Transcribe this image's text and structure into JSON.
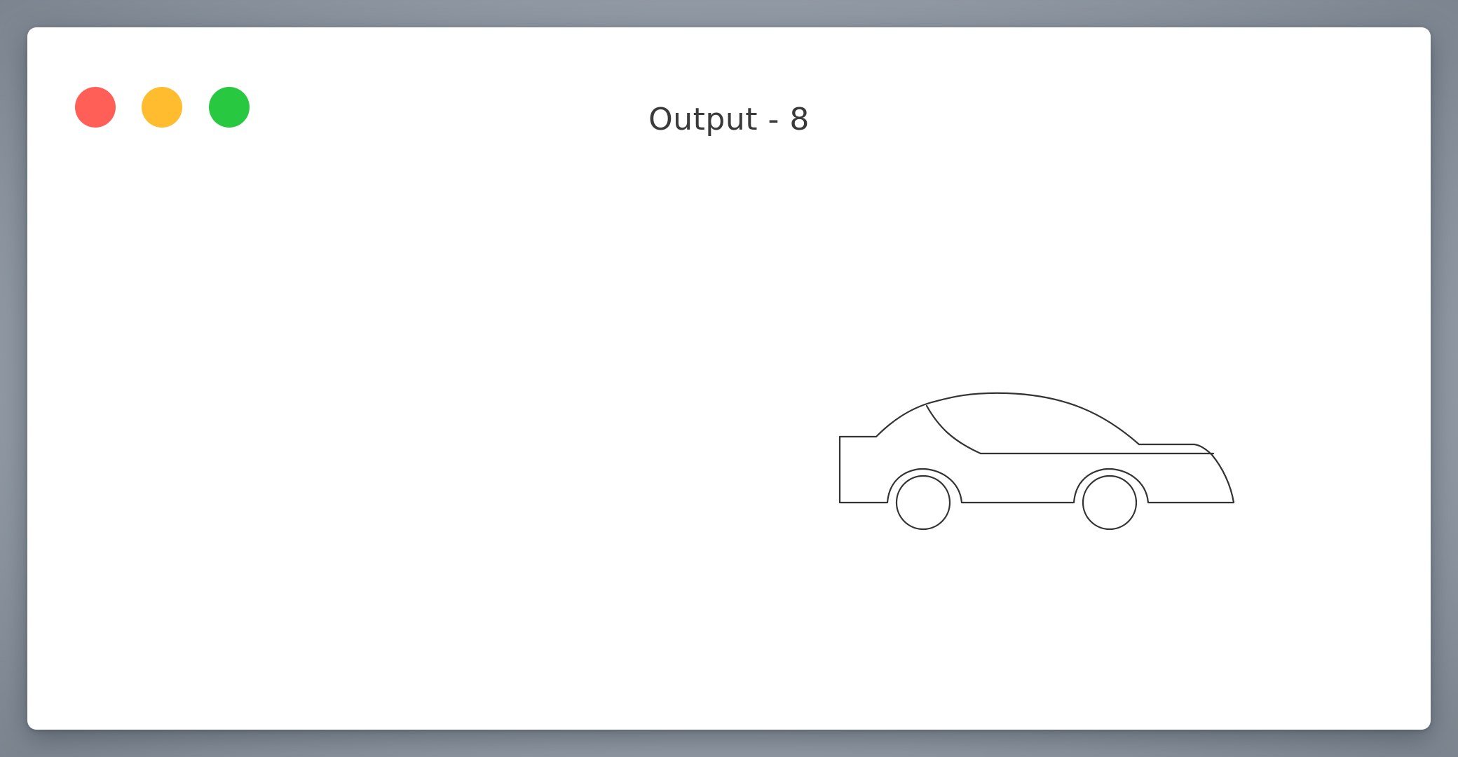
{
  "window": {
    "title": "Output - 8",
    "controls": {
      "close_color": "#ff5f57",
      "minimize_color": "#febc2e",
      "zoom_color": "#28c840"
    }
  },
  "canvas": {
    "background": "#ffffff",
    "drawing": "car-outline",
    "stroke_color": "#333333"
  }
}
